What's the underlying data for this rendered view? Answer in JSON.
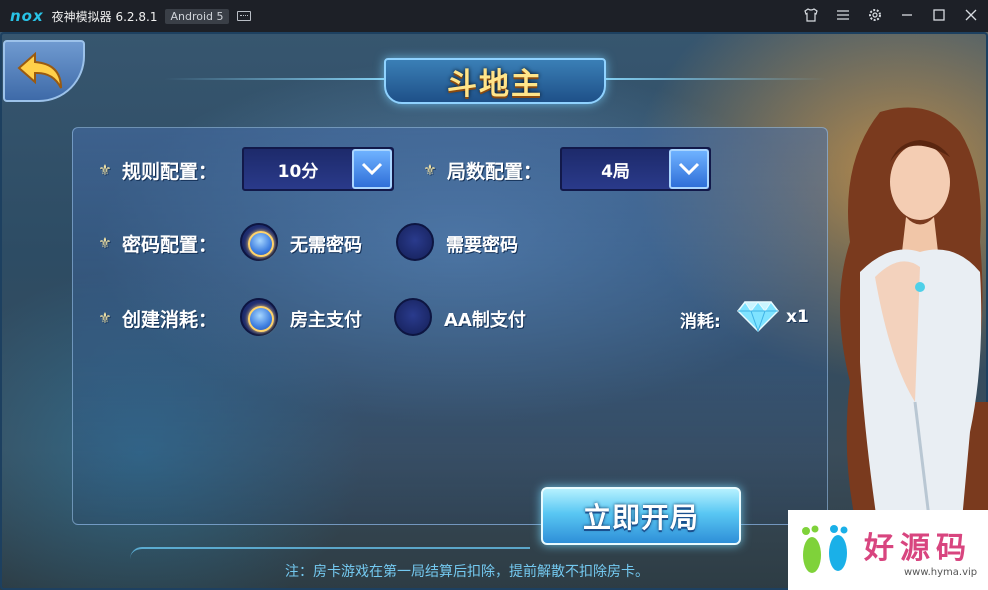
{
  "window": {
    "logo": "nox",
    "title": "夜神模拟器 6.2.8.1",
    "android_badge": "Android 5",
    "icons": [
      "keyboard-icon",
      "shirt-icon",
      "menu-icon",
      "gear-icon",
      "minimize-icon",
      "maximize-icon",
      "close-icon"
    ]
  },
  "game": {
    "title": "斗地主",
    "rules": {
      "rule_label": "规则配置：",
      "rule_value": "10分",
      "rounds_label": "局数配置：",
      "rounds_value": "4局"
    },
    "password": {
      "label": "密码配置：",
      "options": [
        {
          "label": "无需密码",
          "selected": true
        },
        {
          "label": "需要密码",
          "selected": false
        }
      ]
    },
    "consumption": {
      "label": "创建消耗：",
      "options": [
        {
          "label": "房主支付",
          "selected": true
        },
        {
          "label": "AA制支付",
          "selected": false
        }
      ],
      "cost_label": "消耗:",
      "cost_value": "x1"
    },
    "start_button": "立即开局",
    "note": "注：房卡游戏在第一局结算后扣除，提前解散不扣除房卡。"
  },
  "watermark": {
    "brand": "好源码",
    "url": "www.hyma.vip"
  },
  "colors": {
    "title_bar": "#1d2027",
    "accent_blue": "#2f6fd8",
    "title_gold": "#ffe58a",
    "note_cyan": "#74c9f0",
    "watermark_pink": "#d8457f"
  }
}
